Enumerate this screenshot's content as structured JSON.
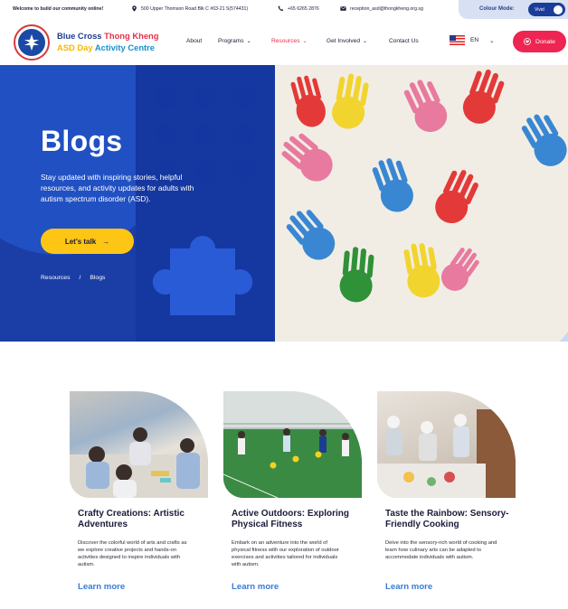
{
  "topbar": {
    "welcome": "Welcome to build our community online!",
    "address": "500 Upper Thomson Road Blk C #03-21 S(574431)",
    "phone": "+65 6265 2876",
    "email": "reception_asd@thongkheng.org.sg",
    "colour_mode_label": "Colour Mode:",
    "colour_mode_value": "Vivid"
  },
  "brand": {
    "line1_a": "Blue Cross ",
    "line1_b": "Thong Kheng",
    "line2_a": "ASD Day ",
    "line2_b": "Activity Centre"
  },
  "nav": {
    "about": "About",
    "programs": "Programs",
    "resources": "Resources",
    "get_involved": "Get Involved",
    "contact": "Contact Us",
    "lang": "EN",
    "donate": "Donate"
  },
  "hero": {
    "title": "Blogs",
    "description": "Stay updated with inspiring stories, helpful resources, and activity updates for adults with autism spectrum disorder (ASD).",
    "cta": "Let's talk",
    "breadcrumb": [
      "Resources",
      "/",
      "Blogs"
    ]
  },
  "cards": [
    {
      "title": "Crafty Creations: Artistic Adventures",
      "text": "Discover the colorful world of arts and crafts as we explore creative projects and hands-on activities designed to inspire individuals with autism.",
      "link": "Learn more"
    },
    {
      "title": "Active Outdoors: Exploring Physical Fitness",
      "text": "Embark on an adventure into the world of physical fitness with our exploration of outdoor exercises and activities tailored for individuals with autism.",
      "link": "Learn more"
    },
    {
      "title": "Taste the Rainbow: Sensory-Friendly Cooking",
      "text": "Delve into the sensory-rich world of cooking and learn how culinary arts can be adapted to accommodate individuals with autism.",
      "link": "Learn more"
    }
  ],
  "colors": {
    "primary_blue": "#1a3ea6",
    "accent_red": "#ee2552",
    "accent_yellow": "#fdc514",
    "link_blue": "#3a7bd5"
  }
}
